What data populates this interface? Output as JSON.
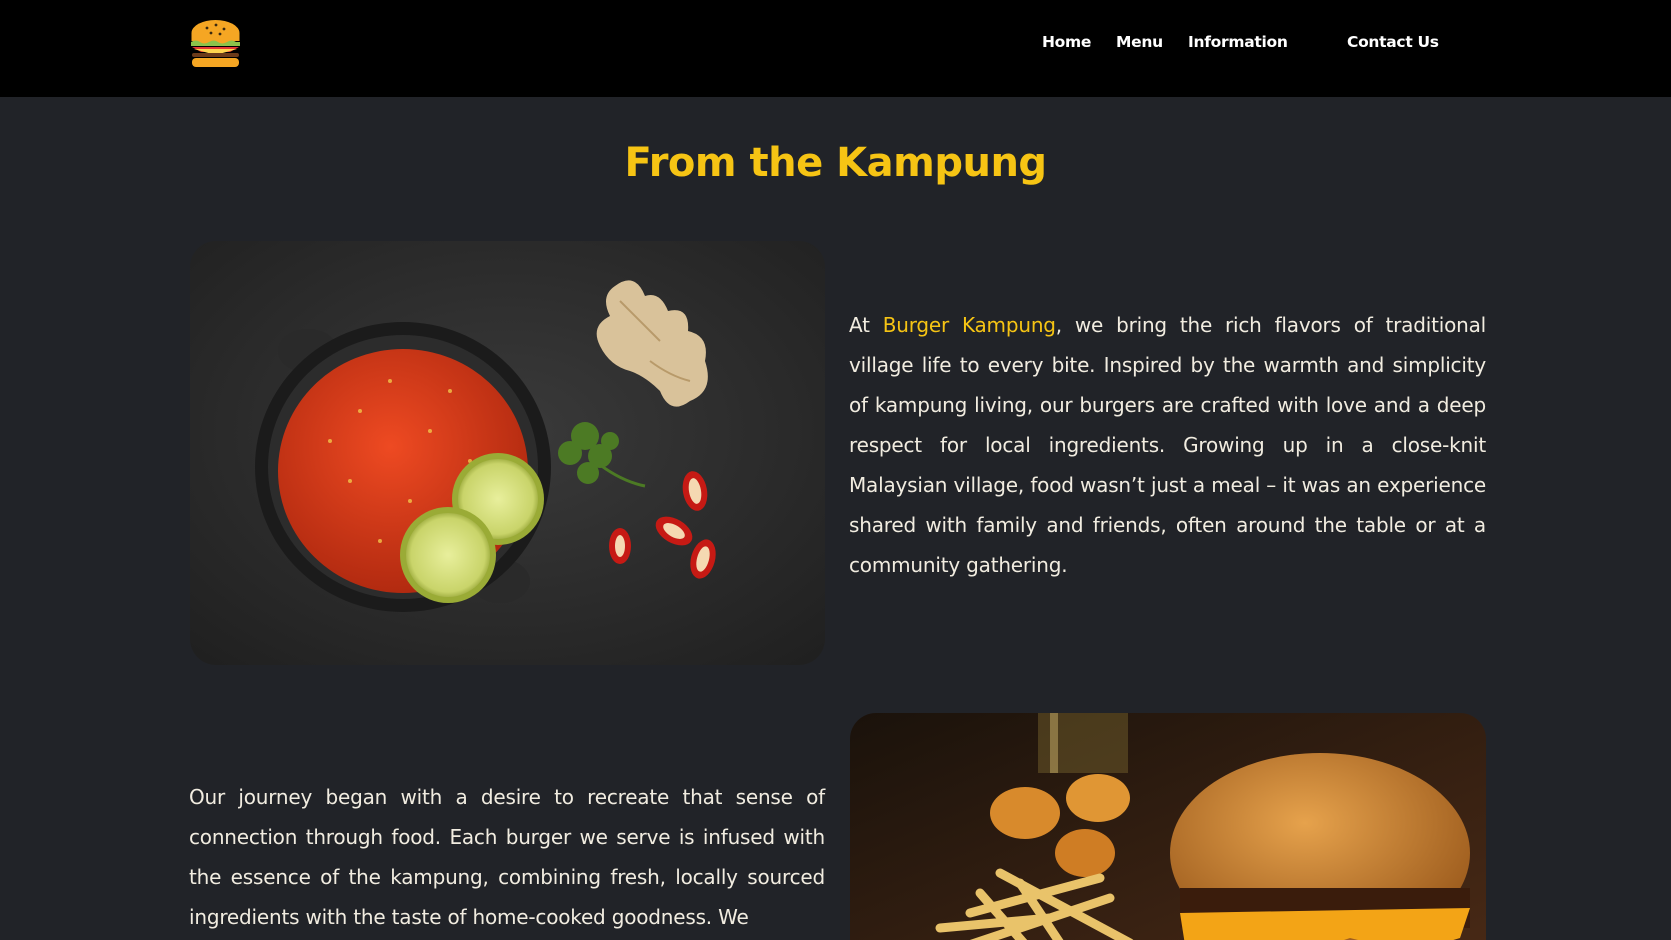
{
  "header": {
    "logo_icon": "burger-icon",
    "nav": {
      "home": "Home",
      "menu": "Menu",
      "information": "Information",
      "contact": "Contact Us"
    }
  },
  "main": {
    "title": "From the Kampung",
    "image_1": "sambal-dish-image",
    "image_2": "burger-fries-image",
    "paragraph_1": {
      "prefix": "At ",
      "brand": "Burger Kampung",
      "body": ", we bring the rich flavors of traditional village life to every bite. Inspired by the warmth and simplicity of kampung living, our burgers are crafted with love and a deep respect for local ingredients. Growing up in a close-knit Malaysian village, food wasn’t just a meal – it was an experience shared with family and friends, often around the table or at a community gathering."
    },
    "paragraph_2": "Our journey began with a desire to recreate that sense of connection through food. Each burger we serve is infused with the essence of the kampung, combining fresh, locally sourced ingredients with the taste of home-cooked goodness. We"
  },
  "colors": {
    "accent": "#f6c414",
    "background": "#212328",
    "nav_background": "#000000",
    "text": "#f1ece0"
  }
}
